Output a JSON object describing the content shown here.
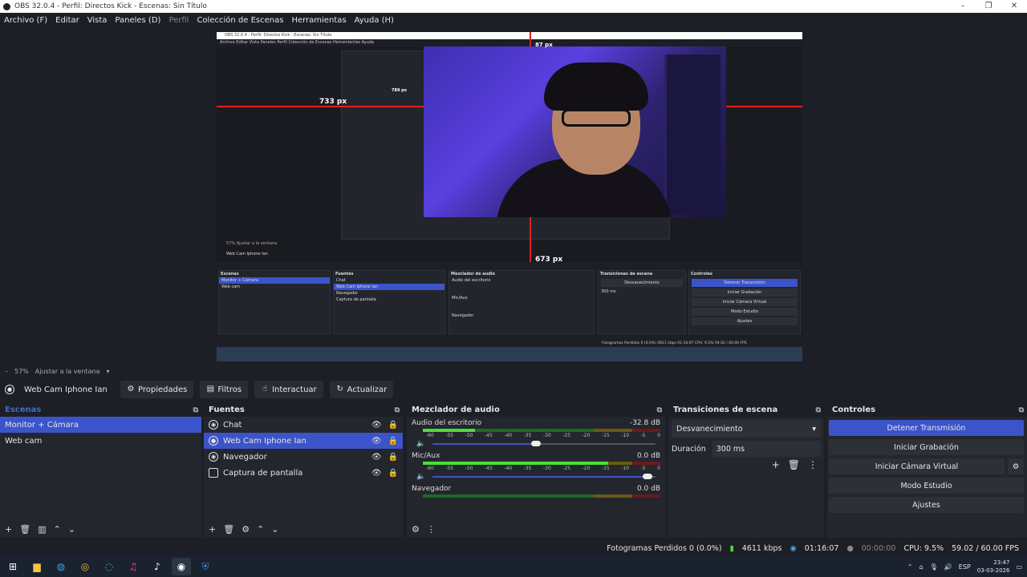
{
  "window": {
    "title": "OBS 32.0.4 - Perfil: Directos Kick - Escenas: Sin Título"
  },
  "menu": [
    "Archivo (F)",
    "Editar",
    "Vista",
    "Paneles (D)",
    "Perfil",
    "Colección de Escenas",
    "Herramientas",
    "Ayuda (H)"
  ],
  "preview": {
    "measure_left": "733 px",
    "measure_top": "87 px",
    "measure_bottom": "673 px",
    "inner_measure": "789 px",
    "inner_title": "OBS 32.0.4 - Perfil: Directos Kick - Escenas: Sin Título",
    "inner_menu": "Archivo  Editar  Vista  Paneles  Perfil  Colección de Escenas  Herramientas  Ayuda",
    "inner_zoom": "57%   Ajustar a la ventana",
    "inner_source": "Web Cam Iphone Ian",
    "inner_status": "Fotogramas Perdidos 0 (0.0%)   4611 kbps   01:16:07   CPU: 9.5%   59.02 / 60.00 FPS"
  },
  "zoom": {
    "level": "57%",
    "fit": "Ajustar a la ventana"
  },
  "source_toolbar": {
    "selected_source": "Web Cam Iphone Ian",
    "properties": "Propiedades",
    "filters": "Filtros",
    "interact": "Interactuar",
    "refresh": "Actualizar"
  },
  "scenes": {
    "header": "Escenas",
    "items": [
      "Monitor + Cámara",
      "Web cam"
    ]
  },
  "sources": {
    "header": "Fuentes",
    "items": [
      "Chat",
      "Web Cam Iphone Ian",
      "Navegador",
      "Captura de pantalla"
    ]
  },
  "mixer": {
    "header": "Mezclador de audio",
    "ticks": [
      "-60",
      "-55",
      "-50",
      "-45",
      "-40",
      "-35",
      "-30",
      "-25",
      "-20",
      "-15",
      "-10",
      "-5",
      "0"
    ],
    "channels": [
      {
        "name": "Audio del escritorio",
        "db": "-32.8 dB",
        "level": 0.22,
        "volume": 0.47
      },
      {
        "name": "Mic/Aux",
        "db": "0.0 dB",
        "level": 0.78,
        "volume": 1.0
      },
      {
        "name": "Navegador",
        "db": "0.0 dB",
        "level": 0.0,
        "volume": 1.0
      }
    ]
  },
  "transitions": {
    "header": "Transiciones de escena",
    "selected": "Desvanecimiento",
    "duration_label": "Duración",
    "duration_value": "300 ms"
  },
  "controls": {
    "header": "Controles",
    "stop_stream": "Detener Transmisión",
    "start_recording": "Iniciar Grabación",
    "start_virtual_cam": "Iniciar Cámara Virtual",
    "studio_mode": "Modo Estudio",
    "settings": "Ajustes"
  },
  "status": {
    "dropped_frames": "Fotogramas Perdidos 0 (0.0%)",
    "bitrate": "4611 kbps",
    "stream_time": "01:16:07",
    "rec_time": "00:00:00",
    "cpu": "CPU: 9.5%",
    "fps": "59.02 / 60.00 FPS"
  },
  "taskbar": {
    "lang": "ESP",
    "time": "23:47",
    "date": "03-03-2026"
  },
  "colors": {
    "accent": "#3c54c9",
    "background": "#1d1f26",
    "panel": "#24262e",
    "meter_green": "#4ade3a",
    "guide_red": "#e02020"
  }
}
